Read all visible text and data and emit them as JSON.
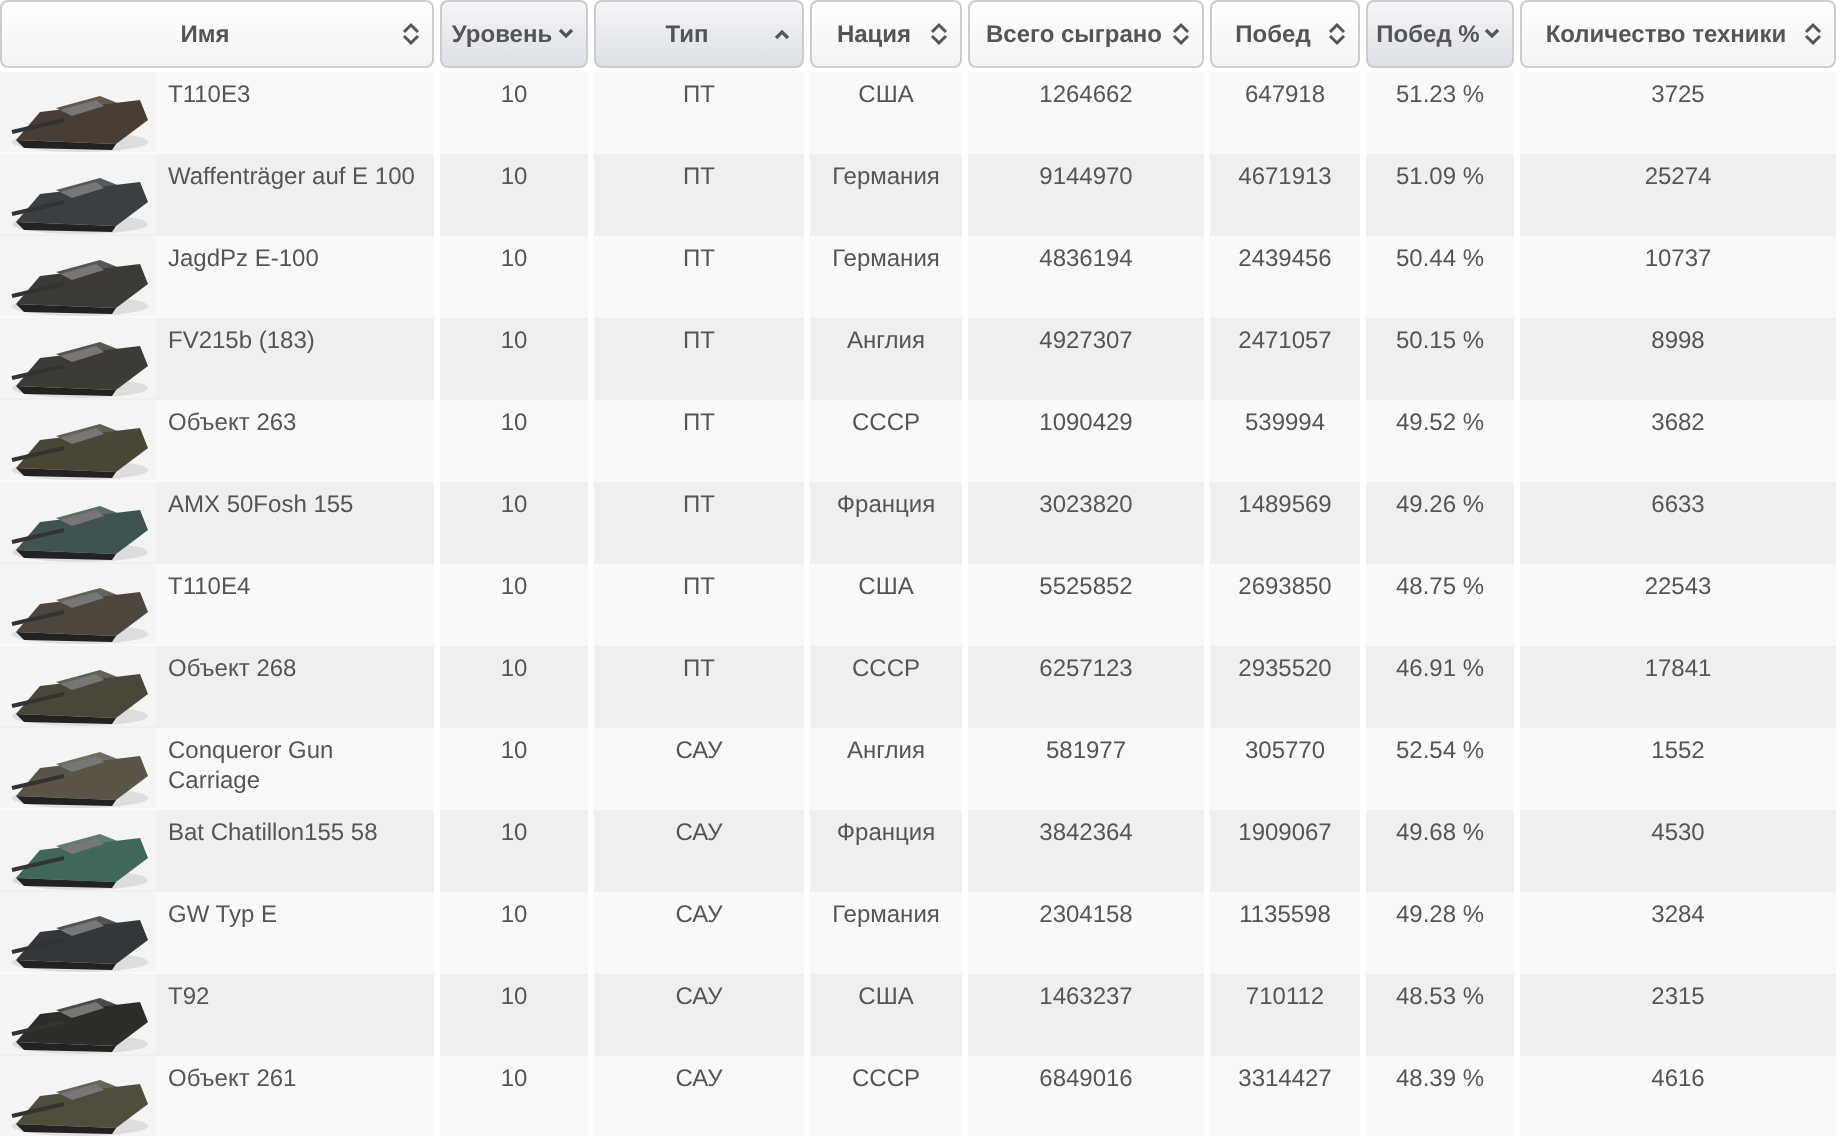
{
  "table": {
    "columns": [
      {
        "label": "Имя",
        "kind": "unsorted"
      },
      {
        "label": "Уровень",
        "kind": "descending"
      },
      {
        "label": "Тип",
        "kind": "ascending"
      },
      {
        "label": "Нация",
        "kind": "unsorted"
      },
      {
        "label": "Всего сыграно",
        "kind": "unsorted"
      },
      {
        "label": "Побед",
        "kind": "unsorted"
      },
      {
        "label": "Побед %",
        "kind": "descending"
      },
      {
        "label": "Количество техники",
        "kind": "unsorted"
      }
    ],
    "rows": [
      {
        "cells": [
          "T110E3",
          "10",
          "ПТ",
          "США",
          "1264662",
          "647918",
          "51.23 %",
          "3725"
        ]
      },
      {
        "cells": [
          "Waffenträger auf E 100",
          "10",
          "ПТ",
          "Германия",
          "9144970",
          "4671913",
          "51.09 %",
          "25274"
        ]
      },
      {
        "cells": [
          "JagdPz E-100",
          "10",
          "ПТ",
          "Германия",
          "4836194",
          "2439456",
          "50.44 %",
          "10737"
        ]
      },
      {
        "cells": [
          "FV215b (183)",
          "10",
          "ПТ",
          "Англия",
          "4927307",
          "2471057",
          "50.15 %",
          "8998"
        ]
      },
      {
        "cells": [
          "Объект 263",
          "10",
          "ПТ",
          "СССР",
          "1090429",
          "539994",
          "49.52 %",
          "3682"
        ]
      },
      {
        "cells": [
          "AMX 50Fosh 155",
          "10",
          "ПТ",
          "Франция",
          "3023820",
          "1489569",
          "49.26 %",
          "6633"
        ]
      },
      {
        "cells": [
          "T110E4",
          "10",
          "ПТ",
          "США",
          "5525852",
          "2693850",
          "48.75 %",
          "22543"
        ]
      },
      {
        "cells": [
          "Объект 268",
          "10",
          "ПТ",
          "СССР",
          "6257123",
          "2935520",
          "46.91 %",
          "17841"
        ]
      },
      {
        "cells": [
          "Conqueror Gun Carriage",
          "10",
          "САУ",
          "Англия",
          "581977",
          "305770",
          "52.54 %",
          "1552"
        ]
      },
      {
        "cells": [
          "Bat Chatillon155 58",
          "10",
          "САУ",
          "Франция",
          "3842364",
          "1909067",
          "49.68 %",
          "4530"
        ]
      },
      {
        "cells": [
          "GW Typ E",
          "10",
          "САУ",
          "Германия",
          "2304158",
          "1135598",
          "49.28 %",
          "3284"
        ]
      },
      {
        "cells": [
          "T92",
          "10",
          "САУ",
          "США",
          "1463237",
          "710112",
          "48.53 %",
          "2315"
        ]
      },
      {
        "cells": [
          "Объект 261",
          "10",
          "САУ",
          "СССР",
          "6849016",
          "3314427",
          "48.39 %",
          "4616"
        ]
      }
    ]
  }
}
